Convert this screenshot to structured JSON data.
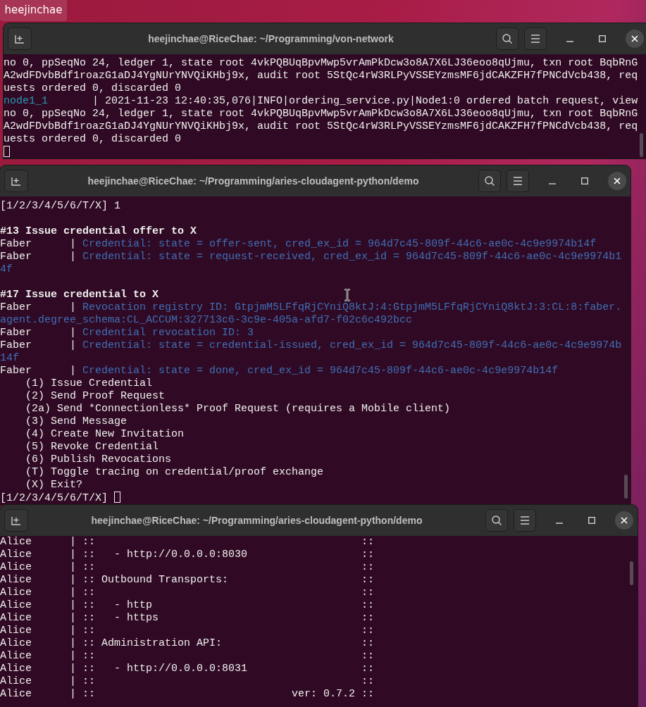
{
  "desktop": {
    "icon_label": "heejinchae"
  },
  "windows": [
    {
      "title": "heejinchae@RiceChae: ~/Programming/von-network",
      "lines": [
        {
          "kind": "text",
          "segments": [
            {
              "kind": "plain",
              "text": "no 0, ppSeqNo 24, ledger 1, state root 4vkPQBUqBpvMwp5vrAmPkDcw3o8A7X6LJ36eoo8qUjmu, txn root BqbRnG"
            }
          ]
        },
        {
          "kind": "text",
          "segments": [
            {
              "kind": "plain",
              "text": "A2wdFDvbBdf1roazG1aDJ4YgNUrYNVQiKHbj9x, audit root 5StQc4rW3RLPyVSSEYzmsMF6jdCAKZFH7fPNCdVcb438, req"
            }
          ]
        },
        {
          "kind": "text",
          "segments": [
            {
              "kind": "plain",
              "text": "uests ordered 0, discarded 0"
            }
          ]
        },
        {
          "kind": "text",
          "segments": [
            {
              "kind": "node",
              "text": "node1_1"
            },
            {
              "kind": "plain",
              "text": "       | 2021-11-23 12:40:35,076|INFO|ordering_service.py|Node1:0 ordered batch request, view"
            }
          ]
        },
        {
          "kind": "text",
          "segments": [
            {
              "kind": "plain",
              "text": "no 0, ppSeqNo 24, ledger 1, state root 4vkPQBUqBpvMwp5vrAmPkDcw3o8A7X6LJ36eoo8qUjmu, txn root BqbRnG"
            }
          ]
        },
        {
          "kind": "text",
          "segments": [
            {
              "kind": "plain",
              "text": "A2wdFDvbBdf1roazG1aDJ4YgNUrYNVQiKHbj9x, audit root 5StQc4rW3RLPyVSSEYzmsMF6jdCAKZFH7fPNCdVcb438, req"
            }
          ]
        },
        {
          "kind": "text",
          "segments": [
            {
              "kind": "plain",
              "text": "uests ordered 0, discarded 0"
            }
          ]
        },
        {
          "kind": "text",
          "segments": [
            {
              "kind": "cursor"
            }
          ]
        }
      ]
    },
    {
      "title": "heejinchae@RiceChae: ~/Programming/aries-cloudagent-python/demo",
      "lines": [
        {
          "kind": "text",
          "segments": [
            {
              "kind": "plain",
              "text": "[1/2/3/4/5/6/T/X] 1"
            }
          ]
        },
        {
          "kind": "blank"
        },
        {
          "kind": "text",
          "segments": [
            {
              "kind": "bold",
              "text": "#13 Issue credential offer to X"
            }
          ]
        },
        {
          "kind": "text",
          "segments": [
            {
              "kind": "plain",
              "text": "Faber      | "
            },
            {
              "kind": "info",
              "text": "Credential: state = offer-sent, cred_ex_id = 964d7c45-809f-44c6-ae0c-4c9e9974b14f"
            }
          ]
        },
        {
          "kind": "text",
          "segments": [
            {
              "kind": "plain",
              "text": "Faber      | "
            },
            {
              "kind": "info",
              "text": "Credential: state = request-received, cred_ex_id = 964d7c45-809f-44c6-ae0c-4c9e9974b1"
            }
          ]
        },
        {
          "kind": "text",
          "segments": [
            {
              "kind": "info",
              "text": "4f"
            }
          ]
        },
        {
          "kind": "blank"
        },
        {
          "kind": "text",
          "segments": [
            {
              "kind": "bold",
              "text": "#17 Issue credential to X"
            }
          ]
        },
        {
          "kind": "text",
          "segments": [
            {
              "kind": "plain",
              "text": "Faber      | "
            },
            {
              "kind": "info",
              "text": "Revocation registry ID: GtpjmM5LFfqRjCYniQ8ktJ:4:GtpjmM5LFfqRjCYniQ8ktJ:3:CL:8:faber."
            }
          ]
        },
        {
          "kind": "text",
          "segments": [
            {
              "kind": "info",
              "text": "agent.degree_schema:CL_ACCUM:327713c6-3c9e-405a-afd7-f02c6c492bcc"
            }
          ]
        },
        {
          "kind": "text",
          "segments": [
            {
              "kind": "plain",
              "text": "Faber      | "
            },
            {
              "kind": "info",
              "text": "Credential revocation ID: 3"
            }
          ]
        },
        {
          "kind": "text",
          "segments": [
            {
              "kind": "plain",
              "text": "Faber      | "
            },
            {
              "kind": "info",
              "text": "Credential: state = credential-issued, cred_ex_id = 964d7c45-809f-44c6-ae0c-4c9e9974b"
            }
          ]
        },
        {
          "kind": "text",
          "segments": [
            {
              "kind": "info",
              "text": "14f"
            }
          ]
        },
        {
          "kind": "text",
          "segments": [
            {
              "kind": "plain",
              "text": "Faber      | "
            },
            {
              "kind": "info",
              "text": "Credential: state = done, cred_ex_id = 964d7c45-809f-44c6-ae0c-4c9e9974b14f"
            }
          ]
        },
        {
          "kind": "text",
          "segments": [
            {
              "kind": "plain",
              "text": "    (1) Issue Credential"
            }
          ]
        },
        {
          "kind": "text",
          "segments": [
            {
              "kind": "plain",
              "text": "    (2) Send Proof Request"
            }
          ]
        },
        {
          "kind": "text",
          "segments": [
            {
              "kind": "plain",
              "text": "    (2a) Send *Connectionless* Proof Request (requires a Mobile client)"
            }
          ]
        },
        {
          "kind": "text",
          "segments": [
            {
              "kind": "plain",
              "text": "    (3) Send Message"
            }
          ]
        },
        {
          "kind": "text",
          "segments": [
            {
              "kind": "plain",
              "text": "    (4) Create New Invitation"
            }
          ]
        },
        {
          "kind": "text",
          "segments": [
            {
              "kind": "plain",
              "text": "    (5) Revoke Credential"
            }
          ]
        },
        {
          "kind": "text",
          "segments": [
            {
              "kind": "plain",
              "text": "    (6) Publish Revocations"
            }
          ]
        },
        {
          "kind": "text",
          "segments": [
            {
              "kind": "plain",
              "text": "    (T) Toggle tracing on credential/proof exchange"
            }
          ]
        },
        {
          "kind": "text",
          "segments": [
            {
              "kind": "plain",
              "text": "    (X) Exit?"
            }
          ]
        },
        {
          "kind": "text",
          "segments": [
            {
              "kind": "plain",
              "text": "[1/2/3/4/5/6/T/X] "
            },
            {
              "kind": "cursor"
            }
          ]
        }
      ]
    },
    {
      "title": "heejinchae@RiceChae: ~/Programming/aries-cloudagent-python/demo",
      "lines": [
        {
          "kind": "text",
          "segments": [
            {
              "kind": "plain",
              "text": "Alice      | ::                                          ::"
            }
          ]
        },
        {
          "kind": "text",
          "segments": [
            {
              "kind": "plain",
              "text": "Alice      | ::   - http://0.0.0.0:8030                  ::"
            }
          ]
        },
        {
          "kind": "text",
          "segments": [
            {
              "kind": "plain",
              "text": "Alice      | ::                                          ::"
            }
          ]
        },
        {
          "kind": "text",
          "segments": [
            {
              "kind": "plain",
              "text": "Alice      | :: Outbound Transports:                     ::"
            }
          ]
        },
        {
          "kind": "text",
          "segments": [
            {
              "kind": "plain",
              "text": "Alice      | ::                                          ::"
            }
          ]
        },
        {
          "kind": "text",
          "segments": [
            {
              "kind": "plain",
              "text": "Alice      | ::   - http                                 ::"
            }
          ]
        },
        {
          "kind": "text",
          "segments": [
            {
              "kind": "plain",
              "text": "Alice      | ::   - https                                ::"
            }
          ]
        },
        {
          "kind": "text",
          "segments": [
            {
              "kind": "plain",
              "text": "Alice      | ::                                          ::"
            }
          ]
        },
        {
          "kind": "text",
          "segments": [
            {
              "kind": "plain",
              "text": "Alice      | :: Administration API:                      ::"
            }
          ]
        },
        {
          "kind": "text",
          "segments": [
            {
              "kind": "plain",
              "text": "Alice      | ::                                          ::"
            }
          ]
        },
        {
          "kind": "text",
          "segments": [
            {
              "kind": "plain",
              "text": "Alice      | ::   - http://0.0.0.0:8031                  ::"
            }
          ]
        },
        {
          "kind": "text",
          "segments": [
            {
              "kind": "plain",
              "text": "Alice      | ::                                          ::"
            }
          ]
        },
        {
          "kind": "text",
          "segments": [
            {
              "kind": "plain",
              "text": "Alice      | ::                               ver: 0.7.2 ::"
            }
          ]
        }
      ]
    }
  ]
}
